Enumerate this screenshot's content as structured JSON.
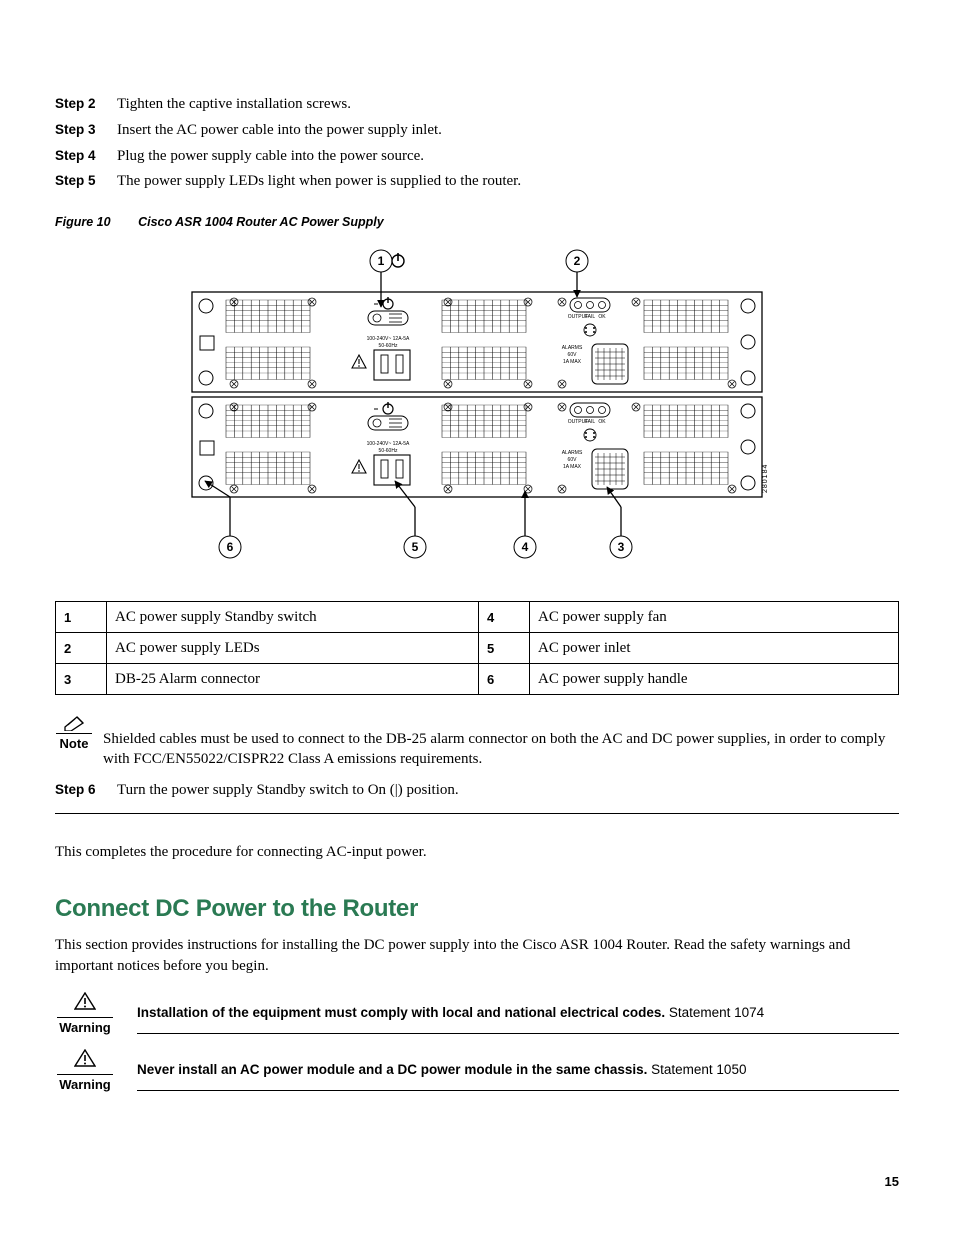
{
  "steps_top": [
    {
      "label": "Step 2",
      "text": "Tighten the captive installation screws."
    },
    {
      "label": "Step 3",
      "text": "Insert the AC power cable into the power supply inlet."
    },
    {
      "label": "Step 4",
      "text": "Plug the power supply cable into the power source."
    },
    {
      "label": "Step 5",
      "text": "The power supply LEDs light when power is supplied to the router."
    }
  ],
  "figure": {
    "label": "Figure 10",
    "title": "Cisco ASR 1004 Router AC Power Supply",
    "callouts": {
      "1": "1",
      "2": "2",
      "3": "3",
      "4": "4",
      "5": "5",
      "6": "6"
    },
    "psu_label_line1": "100-240V~ 12A-5A",
    "psu_label_line2": "50-60Hz",
    "led_labels": {
      "a": "OUTPUT",
      "b": "FAIL",
      "c": "OK"
    },
    "alarm_l1": "ALARMS",
    "alarm_l2": "60V",
    "alarm_l3": "1A MAX",
    "diagram_id": "280184"
  },
  "legend": [
    {
      "n1": "1",
      "d1": "AC power supply Standby switch",
      "n2": "4",
      "d2": "AC power supply fan"
    },
    {
      "n1": "2",
      "d1": "AC power supply LEDs",
      "n2": "5",
      "d2": "AC power inlet"
    },
    {
      "n1": "3",
      "d1": "DB-25 Alarm connector",
      "n2": "6",
      "d2": "AC power supply handle"
    }
  ],
  "note": {
    "label": "Note",
    "body": "Shielded cables must be used to connect to the DB-25 alarm connector on both the AC and DC power supplies, in order to comply with FCC/EN55022/CISPR22 Class A emissions requirements."
  },
  "step6": {
    "label": "Step 6",
    "text": "Turn the power supply Standby switch to On (|) position."
  },
  "outro": "This completes the procedure for connecting AC-input power.",
  "section": {
    "title": "Connect DC Power to the Router",
    "intro": "This section provides instructions for installing the DC power supply into the Cisco ASR 1004 Router. Read the safety warnings and important notices before you begin."
  },
  "warnings": [
    {
      "label": "Warning",
      "bold": "Installation of the equipment must comply with local and national electrical codes.",
      "rest": " Statement 1074"
    },
    {
      "label": "Warning",
      "bold": "Never install an AC power module and a DC power module in the same chassis.",
      "rest": " Statement 1050"
    }
  ],
  "page_number": "15"
}
